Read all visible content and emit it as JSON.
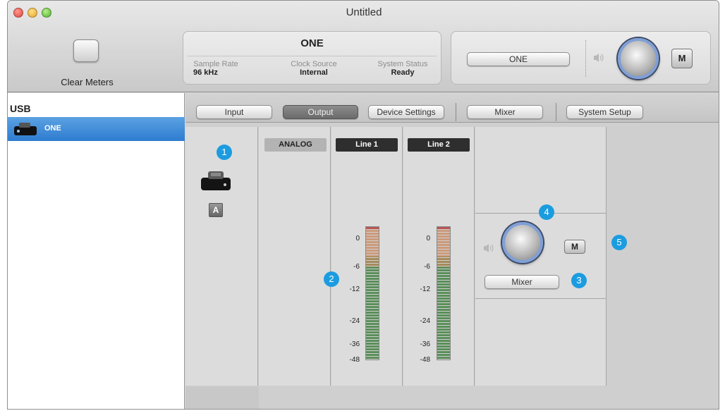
{
  "window": {
    "title": "Untitled"
  },
  "toolbar": {
    "clear_meters": "Clear Meters"
  },
  "status": {
    "device": "ONE",
    "sample_rate_label": "Sample Rate",
    "sample_rate": "96 kHz",
    "clock_label": "Clock Source",
    "clock": "Internal",
    "system_label": "System Status",
    "system": "Ready"
  },
  "monitor": {
    "device_button": "ONE",
    "mute": "M"
  },
  "sidebar": {
    "header": "USB",
    "device": "ONE"
  },
  "tabs": [
    "Input",
    "Output",
    "Device Settings",
    "Mixer",
    "System Setup"
  ],
  "output": {
    "channel_badge": "A",
    "analog": "ANALOG",
    "line1": "Line 1",
    "line2": "Line 2",
    "scale": [
      "0",
      "-6",
      "-12",
      "-24",
      "-36",
      "-48"
    ],
    "mixer_button": "Mixer",
    "mute": "M"
  },
  "callouts": [
    "1",
    "2",
    "3",
    "4",
    "5"
  ],
  "colors": {
    "accent": "#1c9ce0",
    "selection": "#3a86d6"
  }
}
